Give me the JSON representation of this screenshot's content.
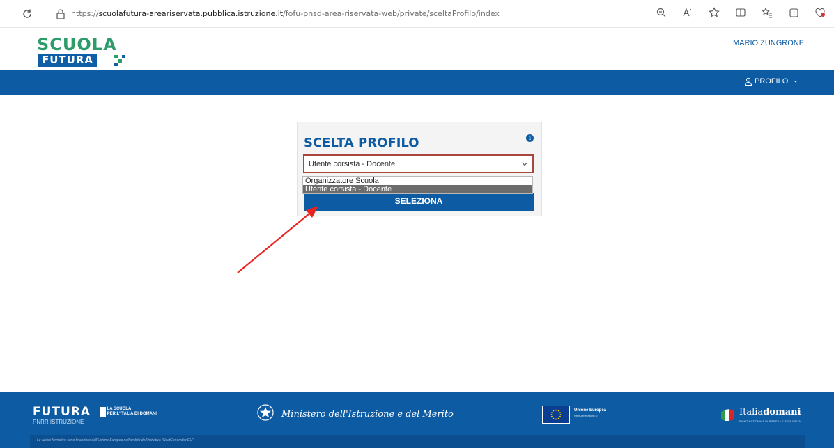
{
  "browser": {
    "url_prefix": "https://",
    "url_domain": "scuolafutura-areariservata.pubblica.istruzione.it",
    "url_path": "/fofu-pnsd-area-riservata-web/private/sceltaProfilo/index",
    "icons": [
      "zoom-icon",
      "read-aloud-icon",
      "favorite-icon",
      "split-screen-icon",
      "favorites-bar-icon",
      "collections-icon",
      "browser-essentials-icon"
    ]
  },
  "header": {
    "logo_top": "SCUOLA",
    "logo_bottom": "FUTURA",
    "user_name": "MARIO ZUNGRONE"
  },
  "nav": {
    "profilo_label": "PROFILO"
  },
  "card": {
    "title": "SCELTA PROFILO",
    "info_glyph": "i",
    "select_value": "Utente corsista - Docente",
    "button_label": "SELEZIONA"
  },
  "dropdown": {
    "options": [
      "Organizzatore Scuola",
      "Utente corsista - Docente"
    ],
    "selected_index": 1
  },
  "footer": {
    "futura_word": "FUTURA",
    "futura_sub_1": "LA SCUOLA",
    "futura_sub_2": "PER L'ITALIA DI DOMANI",
    "pnrr": "PNRR ISTRUZIONE",
    "ministero": "Ministero dell'Istruzione e del Merito",
    "eu_title": "Unione Europea",
    "eu_sub": "NextGenerationEU",
    "italia_prefix": "Italia",
    "italia_bold": "domani",
    "italia_sub": "PIANO NAZIONALE DI RIPRESA E RESILIENZA",
    "note": "Le azioni formative sono finanziate dall'Unione Europea nell'ambito dell'iniziativa \"NextGenerationEU\""
  },
  "colors": {
    "brand_blue": "#0d5ba3",
    "brand_green": "#2e9b6a",
    "select_border": "#a8453c",
    "arrow": "#e8231f"
  }
}
